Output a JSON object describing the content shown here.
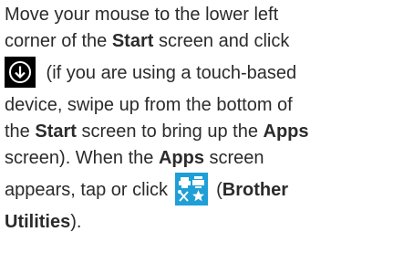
{
  "instruction": {
    "line1": "Move your mouse to the lower left",
    "line2_a": "corner of the ",
    "line2_b": "Start",
    "line2_c": " screen and click",
    "line3": " (if you are using a touch-based",
    "line4": "device, swipe up from the bottom of",
    "line5_a": "the ",
    "line5_b": "Start",
    "line5_c": " screen to bring up the ",
    "line5_d": "Apps",
    "line6_a": "screen). When the ",
    "line6_b": "Apps",
    "line6_c": " screen",
    "line7_a": "appears, tap or click ",
    "line7_b": " (",
    "line7_c": "Brother",
    "line8_a": "Utilities",
    "line8_b": ")."
  },
  "icons": {
    "apps_arrow": "down-arrow-circle-icon",
    "brother_utilities": "brother-utilities-icon",
    "arrow_tile_color": "#000000",
    "utilities_tile_color": "#1f9fd6"
  }
}
